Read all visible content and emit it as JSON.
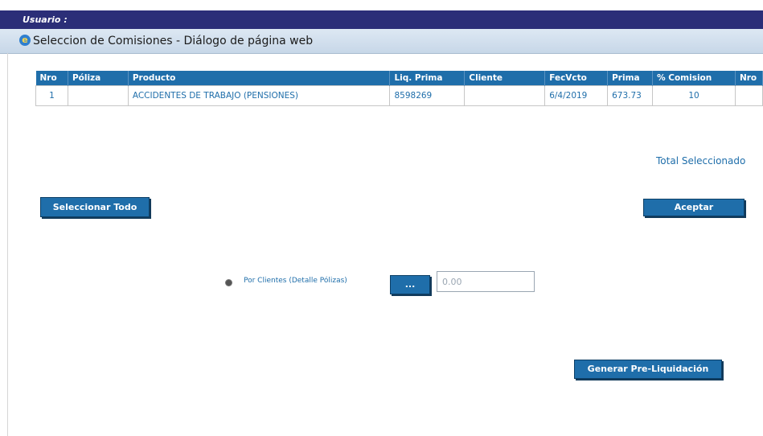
{
  "header": {
    "usuario_label": "Usuario :"
  },
  "dialog": {
    "title": "Seleccion de Comisiones - Diálogo de página web"
  },
  "table": {
    "columns": [
      "Nro",
      "Póliza",
      "Producto",
      "Liq. Prima",
      "Cliente",
      "FecVcto",
      "Prima",
      "% Comision",
      "Nro"
    ],
    "rows": [
      {
        "nro": "1",
        "poliza": "",
        "producto": "ACCIDENTES DE TRABAJO (PENSIONES)",
        "liq_prima": "8598269",
        "cliente": "",
        "fecvcto": "6/4/2019",
        "prima": "673.73",
        "comision": "10",
        "nro2": ""
      }
    ]
  },
  "total_label": "Total Seleccionado",
  "buttons": {
    "select_all": "Seleccionar Todo",
    "accept": "Aceptar",
    "generate": "Generar Pre-Liquidación",
    "dots": "..."
  },
  "option": {
    "label": "Por Clientes (Detalle Pólizas)"
  },
  "amount_input": {
    "value": "0.00"
  },
  "colors": {
    "accent": "#1f6eaa",
    "header_bar": "#2b2e78"
  }
}
